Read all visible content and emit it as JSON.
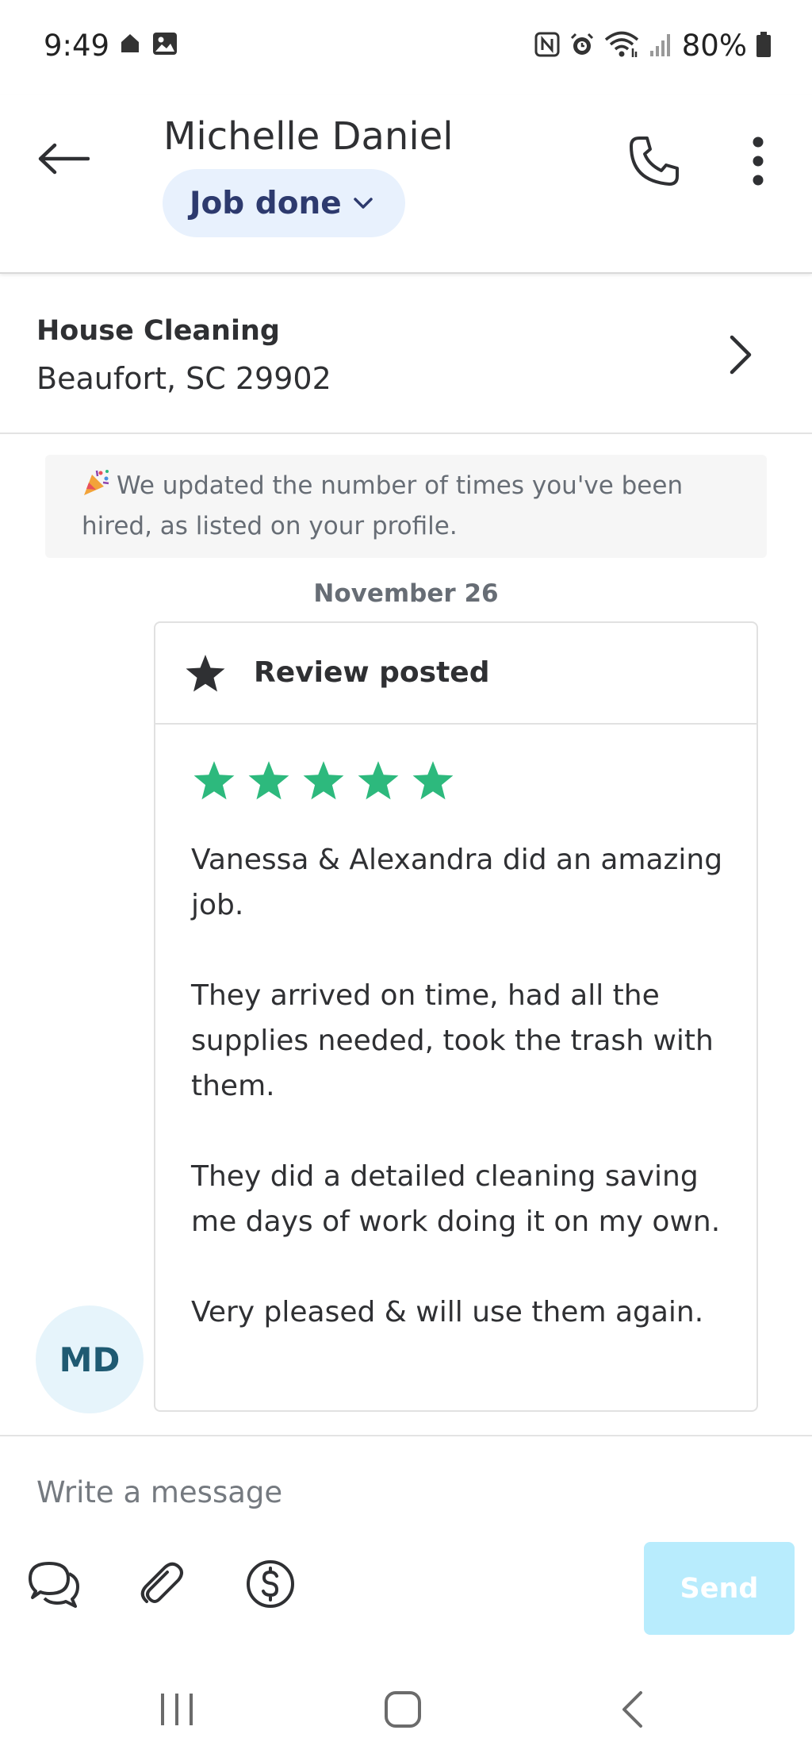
{
  "status_bar": {
    "time": "9:49",
    "battery": "80%",
    "icons": [
      "home-icon",
      "gallery-icon",
      "nfc-icon",
      "alarm-icon",
      "wifi-icon",
      "signal-icon",
      "battery-icon"
    ]
  },
  "header": {
    "contact_name": "Michelle Daniel",
    "status_label": "Job done",
    "icons": [
      "back-arrow-icon",
      "chevron-down-icon",
      "phone-icon",
      "more-vertical-icon"
    ]
  },
  "job": {
    "title": "House Cleaning",
    "location": "Beaufort, SC 29902"
  },
  "notice": {
    "text": "We updated the number of times you've been hired, as listed on your profile.",
    "icon": "party-popper-icon"
  },
  "conversation": {
    "date": "November 26",
    "review": {
      "header_label": "Review posted",
      "rating": 5,
      "rating_max": 5,
      "star_color": "#2db97d",
      "paragraphs": [
        "Vanessa & Alexandra did an amazing job.",
        "They arrived on time, had all the supplies needed, took the trash with them.",
        "They did a detailed cleaning saving me days of work doing it on my own.",
        "Very pleased & will use them again."
      ]
    },
    "avatar_initials": "MD"
  },
  "composer": {
    "placeholder": "Write a message",
    "send_label": "Send",
    "send_color": "#b8ecfd",
    "tools": [
      "quick-replies-icon",
      "attachment-icon",
      "payment-icon"
    ]
  },
  "nav_bar": {
    "buttons": [
      "recent-apps-icon",
      "home-button-icon",
      "back-nav-icon"
    ]
  }
}
